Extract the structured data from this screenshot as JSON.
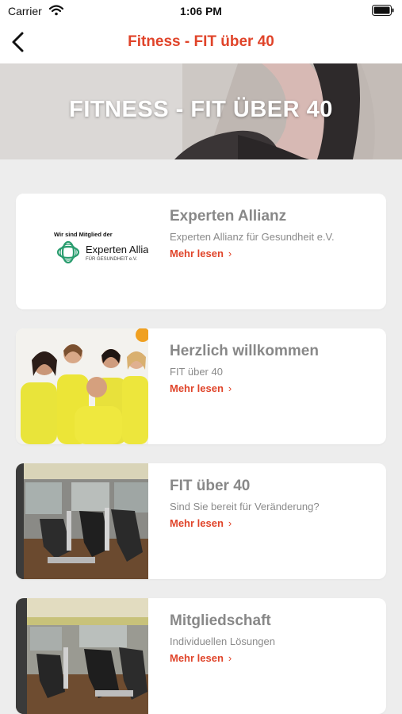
{
  "status_bar": {
    "carrier": "Carrier",
    "time": "1:06 PM",
    "icons": [
      "wifi-icon",
      "battery-icon"
    ]
  },
  "nav": {
    "back_icon": "chevron-left-icon",
    "title": "Fitness - FIT über 40"
  },
  "hero": {
    "title": "FITNESS - FIT ÜBER 40"
  },
  "cards": [
    {
      "title": "Experten Allianz",
      "subtitle": "Experten Allianz für Gesundheit e.V.",
      "link": "Mehr lesen",
      "logo_caption": "Wir sind Mitglied der",
      "logo_name": "Experten Allia",
      "logo_sub": "FÜR GESUNDHEIT e.V."
    },
    {
      "title": "Herzlich willkommen",
      "subtitle": "FIT über 40",
      "link": "Mehr lesen"
    },
    {
      "title": "FIT über 40",
      "subtitle": "Sind Sie bereit für Veränderung?",
      "link": "Mehr lesen"
    },
    {
      "title": "Mitgliedschaft",
      "subtitle": "Individuellen Lösungen",
      "link": "Mehr lesen"
    }
  ],
  "colors": {
    "accent": "#e0442a",
    "background": "#ededed",
    "card": "#ffffff",
    "card_title": "#888888",
    "logo_green": "#2a9d6f"
  }
}
